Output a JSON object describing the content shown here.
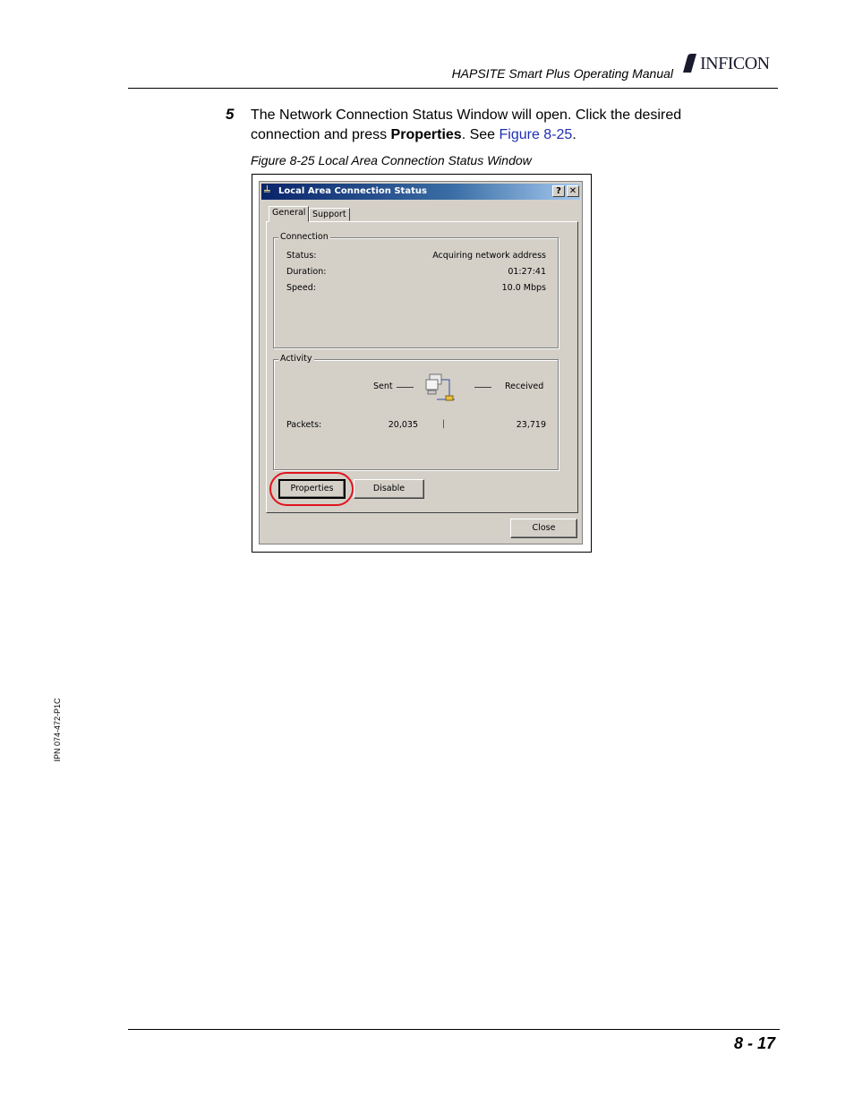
{
  "header": {
    "manual_title": "HAPSITE Smart Plus Operating Manual",
    "logo_text": "INFICON"
  },
  "step": {
    "number": "5",
    "text_part1": "The Network Connection Status Window will open. Click the desired connection and press ",
    "bold_word": "Properties",
    "text_part2": ". See ",
    "link_text": "Figure 8-25",
    "text_part3": "."
  },
  "figure": {
    "caption": "Figure 8-25  Local Area Connection Status Window"
  },
  "dialog": {
    "title": "Local Area Connection Status",
    "help_label": "?",
    "close_label": "✕",
    "tabs": [
      {
        "label": "General",
        "active": true
      },
      {
        "label": "Support",
        "active": false
      }
    ],
    "connection": {
      "legend": "Connection",
      "status_label": "Status:",
      "status_value": "Acquiring network address",
      "duration_label": "Duration:",
      "duration_value": "01:27:41",
      "speed_label": "Speed:",
      "speed_value": "10.0 Mbps"
    },
    "activity": {
      "legend": "Activity",
      "sent_label": "Sent",
      "received_label": "Received",
      "packets_label": "Packets:",
      "packets_sent": "20,035",
      "packets_received": "23,719",
      "separator": "|"
    },
    "buttons": {
      "properties": "Properties",
      "disable": "Disable",
      "close": "Close"
    },
    "highlight_color": "#e0141e",
    "titlebar_color": "#0a246a"
  },
  "side_label": "IPN 074-472-P1C",
  "footer": {
    "page_number": "8 - 17"
  }
}
